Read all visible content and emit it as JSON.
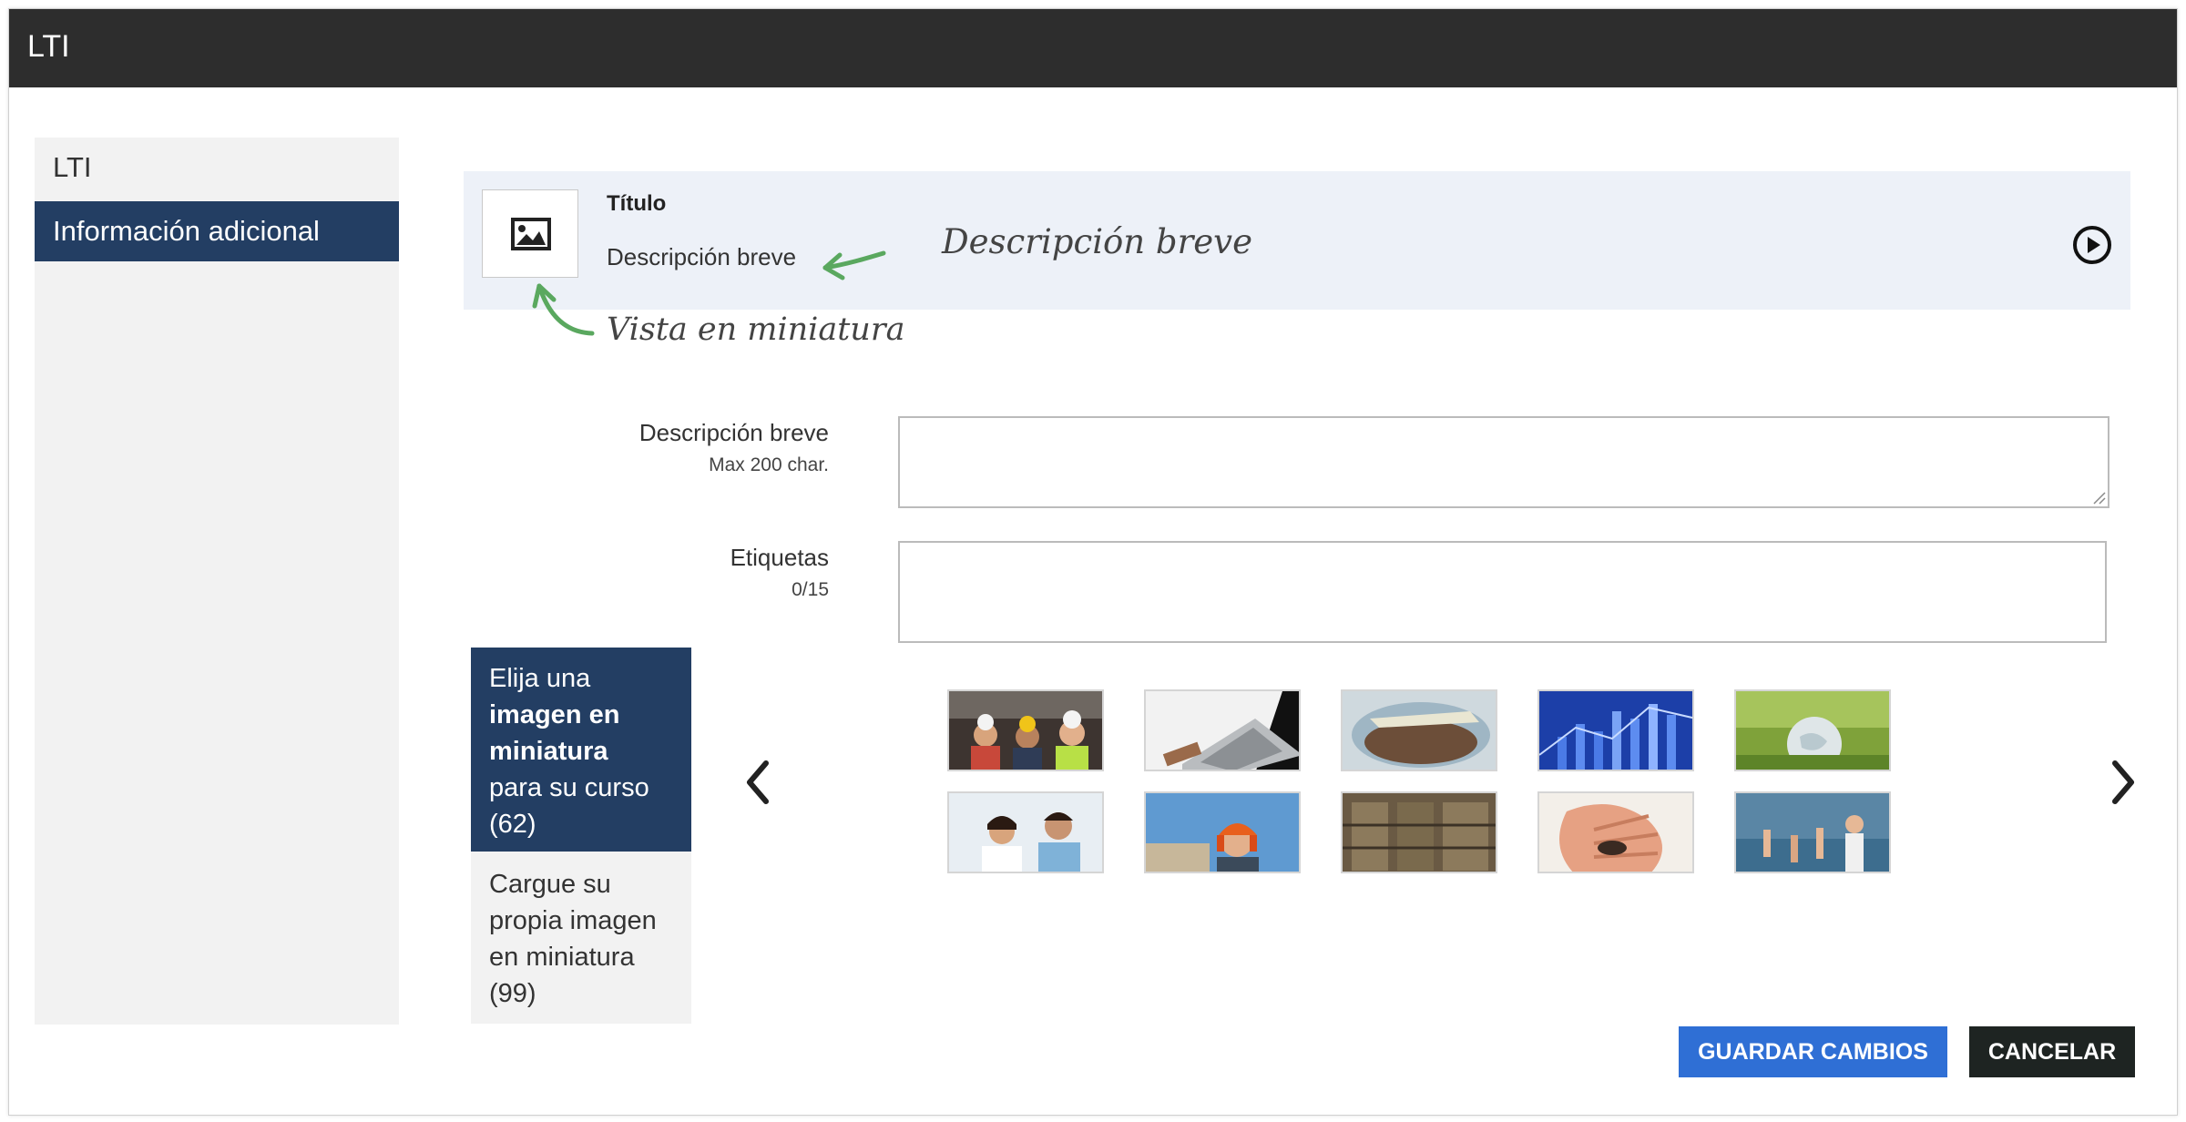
{
  "window": {
    "title": "LTI"
  },
  "sidebar": {
    "items": [
      {
        "label": "LTI"
      },
      {
        "label": "Información adicional"
      }
    ]
  },
  "preview": {
    "title": "Título",
    "short_description": "Descripción breve",
    "annotation_description": "Descripción breve",
    "annotation_thumbnail": "Vista en miniatura",
    "thumbnail_icon": "image-icon",
    "play_icon": "play-circle-icon"
  },
  "form": {
    "short_description": {
      "label": "Descripción breve",
      "hint": "Max 200 char.",
      "value": ""
    },
    "tags": {
      "label": "Etiquetas",
      "hint": "0/15",
      "value": ""
    }
  },
  "thumbnail_tabs": {
    "choose": {
      "line1": "Elija una",
      "bold": "imagen en miniatura",
      "line2": "para su curso (62)"
    },
    "upload": {
      "label": "Cargue su propia imagen en miniatura (99)"
    }
  },
  "gallery": {
    "prev_icon": "chevron-left-icon",
    "next_icon": "chevron-right-icon",
    "images": [
      "workers-photo",
      "laptop-photo",
      "grain-photo",
      "chart-photo",
      "globe-grass-photo",
      "doctors-photo",
      "engineer-photo",
      "warehouse-photo",
      "hand-photo",
      "classroom-photo"
    ]
  },
  "actions": {
    "save_label": "GUARDAR CAMBIOS",
    "cancel_label": "CANCELAR"
  },
  "colors": {
    "titlebar": "#2d2d2d",
    "nav_active": "#233e63",
    "preview_bg": "#edf1f8",
    "save_button": "#2f6fd5",
    "cancel_button": "#1e2422",
    "annotation_arrow": "#5aa85f"
  }
}
